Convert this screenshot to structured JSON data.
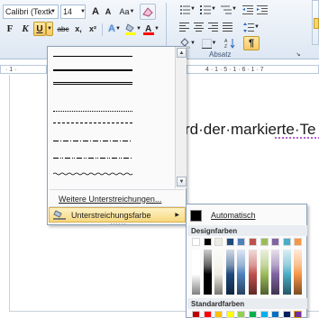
{
  "ribbon": {
    "font_name": "Calibri (Textk",
    "font_size": "14",
    "grow_font": "A",
    "shrink_font": "A",
    "change_case": "Aa",
    "bold": "F",
    "italic": "K",
    "underline": "U",
    "strikethrough": "abc",
    "subscript": "x,",
    "superscript": "x²",
    "paragraph_group_label": "Absatz",
    "ruler_left_text": "· 1 ·",
    "ruler_right_text": "4 · 1 · 5 · 1 · 6 · 1 · 7"
  },
  "document": {
    "visible_text": "rd·der·markierte·Te"
  },
  "underline_menu": {
    "more_underlines_label": "Weitere Unterstreichungen...",
    "underline_color_label": "Unterstreichungsfarbe"
  },
  "color_panel": {
    "automatic_label": "Automatisch",
    "theme_colors_label": "Designfarben",
    "standard_colors_label": "Standardfarben",
    "theme_colors": [
      "#ffffff",
      "#000000",
      "#eeece1",
      "#1f497d",
      "#4f81bd",
      "#c0504d",
      "#9bbb59",
      "#8064a2",
      "#4bacc6",
      "#f79646"
    ],
    "standard_colors": [
      "#c00000",
      "#ff0000",
      "#ffc000",
      "#ffff00",
      "#92d050",
      "#00b050",
      "#00b0f0",
      "#0070c0",
      "#002060",
      "#7030a0"
    ]
  },
  "colors": {
    "highlight_yellow": "#ffff00",
    "font_color_red": "#ff0000",
    "menu_highlight": "#f8d87f"
  }
}
